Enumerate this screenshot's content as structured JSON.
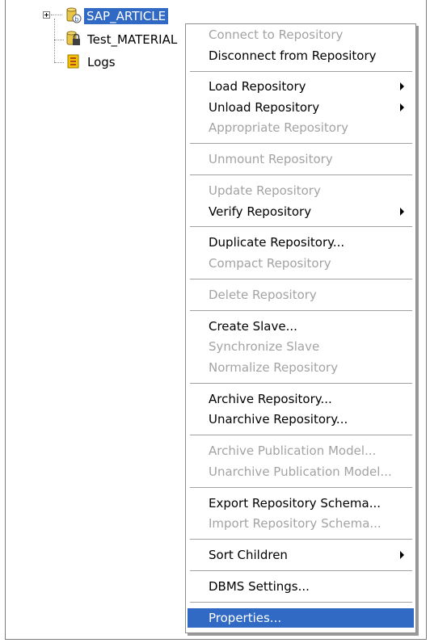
{
  "tree": {
    "nodes": [
      {
        "label": "SAP_ARTICLE",
        "icon": "repository-icon",
        "selected": true
      },
      {
        "label": "Test_MATERIAL",
        "icon": "locked-repository-icon",
        "selected": false
      },
      {
        "label": "Logs",
        "icon": "logs-icon",
        "selected": false
      }
    ]
  },
  "menu": {
    "items": [
      {
        "label": "Connect to Repository",
        "enabled": false
      },
      {
        "label": "Disconnect from Repository",
        "enabled": true
      },
      {
        "label": "Load Repository",
        "enabled": true,
        "submenu": true
      },
      {
        "label": "Unload Repository",
        "enabled": true,
        "submenu": true
      },
      {
        "label": "Appropriate Repository",
        "enabled": false
      },
      {
        "label": "Unmount Repository",
        "enabled": false
      },
      {
        "label": "Update Repository",
        "enabled": false
      },
      {
        "label": "Verify Repository",
        "enabled": true,
        "submenu": true
      },
      {
        "label": "Duplicate Repository...",
        "enabled": true
      },
      {
        "label": "Compact Repository",
        "enabled": false
      },
      {
        "label": "Delete Repository",
        "enabled": false
      },
      {
        "label": "Create Slave...",
        "enabled": true
      },
      {
        "label": "Synchronize Slave",
        "enabled": false
      },
      {
        "label": "Normalize Repository",
        "enabled": false
      },
      {
        "label": "Archive Repository...",
        "enabled": true
      },
      {
        "label": "Unarchive Repository...",
        "enabled": true
      },
      {
        "label": "Archive Publication Model...",
        "enabled": false
      },
      {
        "label": "Unarchive Publication Model...",
        "enabled": false
      },
      {
        "label": "Export Repository Schema...",
        "enabled": true
      },
      {
        "label": "Import Repository Schema...",
        "enabled": false
      },
      {
        "label": "Sort Children",
        "enabled": true,
        "submenu": true
      },
      {
        "label": "DBMS Settings...",
        "enabled": true
      },
      {
        "label": "Properties...",
        "enabled": true,
        "highlighted": true
      }
    ]
  },
  "colors": {
    "selection": "#316ac5",
    "disabled_text": "#a3a3a3"
  }
}
